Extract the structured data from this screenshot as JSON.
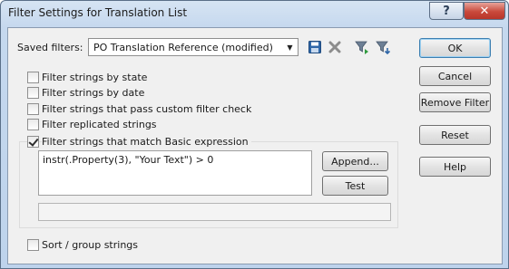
{
  "window": {
    "title": "Filter Settings for Translation List"
  },
  "titlebar": {
    "help_glyph": "?",
    "close_glyph": "✕"
  },
  "saved_filters": {
    "label": "Saved filters:",
    "value": "PO Translation Reference (modified)"
  },
  "toolbar_icons": [
    "save-icon",
    "delete-icon",
    "filter-apply-icon",
    "filter-import-icon"
  ],
  "options": [
    {
      "label": "Filter strings by state",
      "checked": false
    },
    {
      "label": "Filter strings by date",
      "checked": false
    },
    {
      "label": "Filter strings that pass custom filter check",
      "checked": false
    },
    {
      "label": "Filter replicated strings",
      "checked": false
    },
    {
      "label": "Filter strings that match Basic expression",
      "checked": true
    }
  ],
  "expression": {
    "value": "instr(.Property(3), \"Your Text\") > 0"
  },
  "buttons": {
    "append": "Append...",
    "test": "Test",
    "ok": "OK",
    "cancel": "Cancel",
    "remove_filter": "Remove Filter",
    "reset": "Reset",
    "help": "Help"
  },
  "sort_group": {
    "label": "Sort / group strings",
    "checked": false
  },
  "colors": {
    "titlebar_gradient_top": "#d6e4f3",
    "client_background": "#f0f0f0",
    "close_red": "#c9493b",
    "default_button_border": "#3c7fb1"
  }
}
